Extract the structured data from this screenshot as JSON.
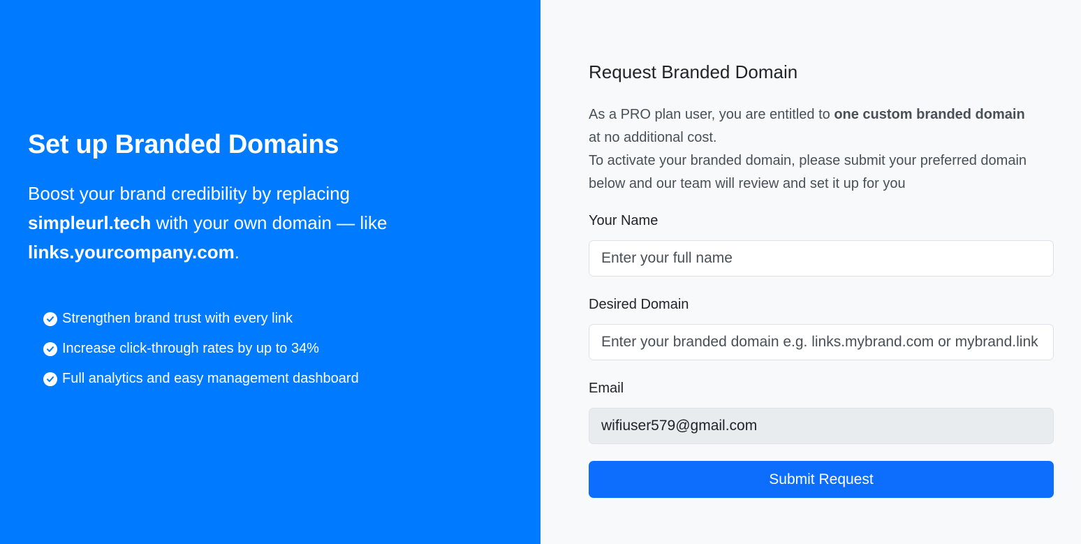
{
  "hero": {
    "title": "Set up Branded Domains",
    "lead_part1": "Boost your brand credibility by replacing ",
    "lead_bold1": "simpleurl.tech",
    "lead_part2": " with your own domain — like ",
    "lead_bold2": "links.yourcompany.com",
    "lead_part3": ".",
    "features": [
      {
        "icon": "check-circle-icon",
        "text": "Strengthen brand trust with every link"
      },
      {
        "icon": "check-circle-icon",
        "text": "Increase click-through rates by up to 34%"
      },
      {
        "icon": "check-circle-icon",
        "text": "Full analytics and easy management dashboard"
      }
    ]
  },
  "form": {
    "title": "Request Branded Domain",
    "intro_part1": "As a PRO plan user, you are entitled to ",
    "intro_bold": "one custom branded domain",
    "intro_part2": " at no additional cost.",
    "intro_line2": "To activate your branded domain, please submit your preferred domain below and our team will review and set it up for you",
    "name_label": "Your Name",
    "name_placeholder": "Enter your full name",
    "domain_label": "Desired Domain",
    "domain_placeholder": "Enter your branded domain e.g. links.mybrand.com or mybrand.link",
    "email_label": "Email",
    "email_value": "wifiuser579@gmail.com",
    "submit_label": "Submit Request"
  },
  "colors": {
    "hero_bg": "#007bff",
    "button_bg": "#0d6efd",
    "panel_bg": "#f8f9fa"
  }
}
